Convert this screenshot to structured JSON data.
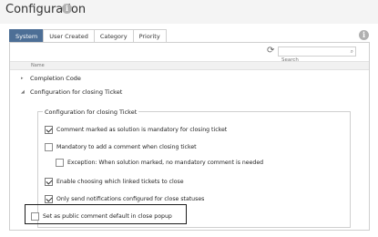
{
  "header": {
    "title": "Configuration",
    "info_icon": "info-icon"
  },
  "tabs": [
    {
      "label": "System",
      "active": true
    },
    {
      "label": "User Created",
      "active": false
    },
    {
      "label": "Category",
      "active": false
    },
    {
      "label": "Priority",
      "active": false
    }
  ],
  "toolbar": {
    "refresh_icon": "refresh-icon",
    "search_placeholder": "Search",
    "search_icon": "search-icon"
  },
  "grid": {
    "column_name": "Name"
  },
  "tree": [
    {
      "label": "Completion Code",
      "expanded": false
    },
    {
      "label": "Configuration for closing Ticket",
      "expanded": true
    }
  ],
  "group": {
    "legend": "Configuration for closing Ticket",
    "options": [
      {
        "label": "Comment marked as solution is mandatory for closing ticket",
        "checked": true
      },
      {
        "label": "Mandatory to add a comment when closing ticket",
        "checked": false
      },
      {
        "label": "Exception: When solution marked, no mandatory comment is needed",
        "checked": false
      },
      {
        "label": "Enable choosing which linked tickets to close",
        "checked": true
      },
      {
        "label": "Only send notifications configured for close statuses",
        "checked": true
      },
      {
        "label": "Set as public comment default in close popup",
        "checked": false
      }
    ]
  },
  "colors": {
    "active_tab": "#4d6f96",
    "border": "#cfcfcf",
    "highlight": "#1c1c1c"
  }
}
